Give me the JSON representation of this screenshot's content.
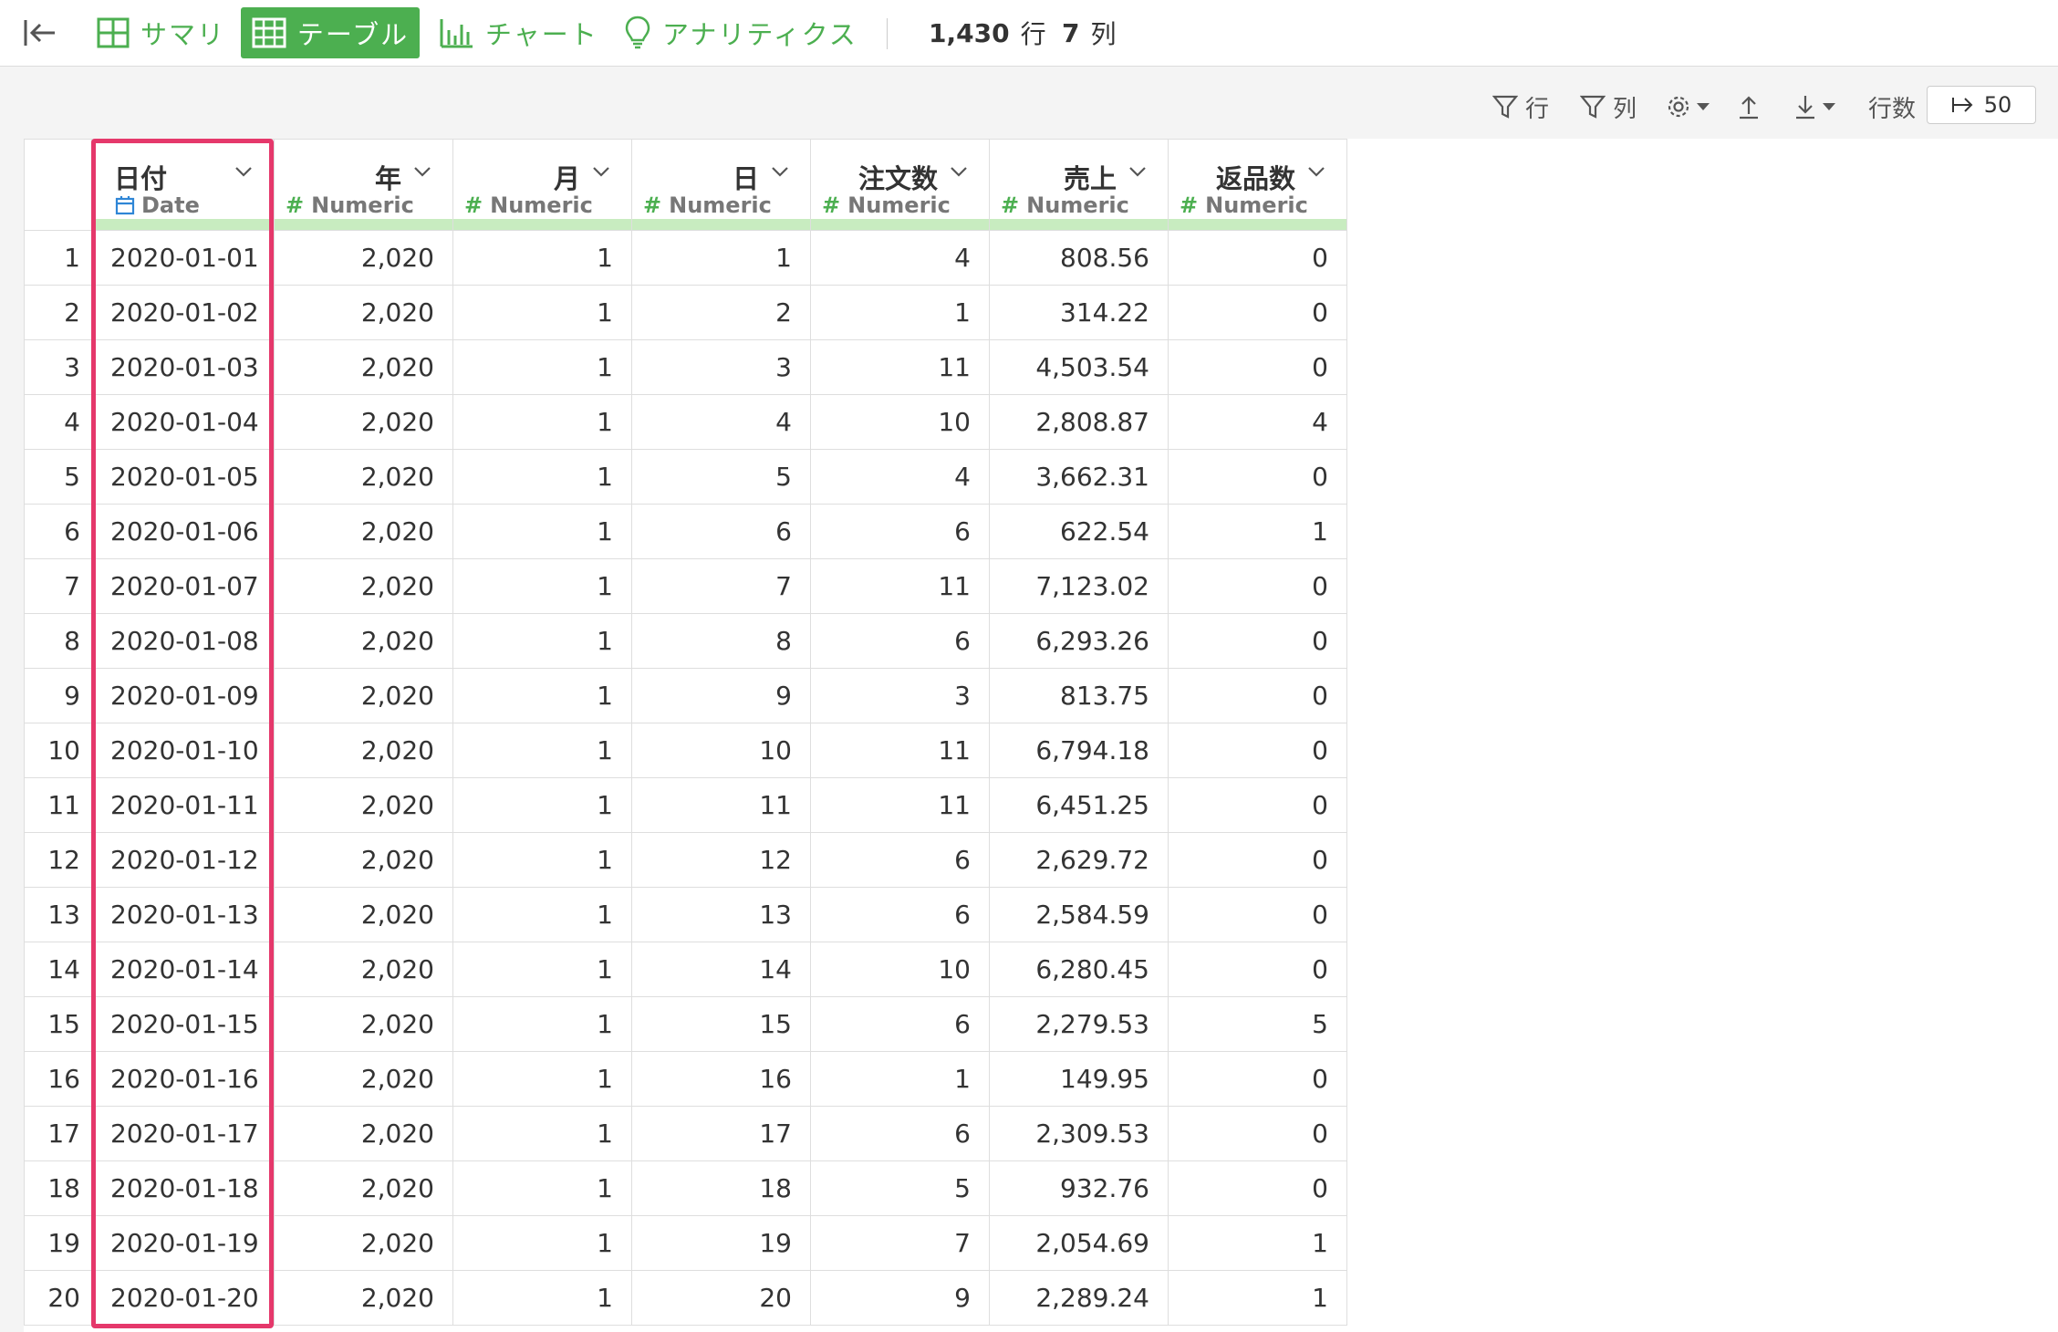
{
  "toolbar": {
    "summary_label": "サマリ",
    "table_label": "テーブル",
    "chart_label": "チャート",
    "analytics_label": "アナリティクス",
    "row_count": "1,430",
    "row_unit": "行",
    "col_count": "7",
    "col_unit": "列"
  },
  "controls": {
    "filter_rows_label": "行",
    "filter_cols_label": "列",
    "rows_label": "行数",
    "rows_value": "50"
  },
  "columns": [
    {
      "name": "日付",
      "type": "Date"
    },
    {
      "name": "年",
      "type": "Numeric"
    },
    {
      "name": "月",
      "type": "Numeric"
    },
    {
      "name": "日",
      "type": "Numeric"
    },
    {
      "name": "注文数",
      "type": "Numeric"
    },
    {
      "name": "売上",
      "type": "Numeric"
    },
    {
      "name": "返品数",
      "type": "Numeric"
    }
  ],
  "rows": [
    [
      "1",
      "2020-01-01",
      "2,020",
      "1",
      "1",
      "4",
      "808.56",
      "0"
    ],
    [
      "2",
      "2020-01-02",
      "2,020",
      "1",
      "2",
      "1",
      "314.22",
      "0"
    ],
    [
      "3",
      "2020-01-03",
      "2,020",
      "1",
      "3",
      "11",
      "4,503.54",
      "0"
    ],
    [
      "4",
      "2020-01-04",
      "2,020",
      "1",
      "4",
      "10",
      "2,808.87",
      "4"
    ],
    [
      "5",
      "2020-01-05",
      "2,020",
      "1",
      "5",
      "4",
      "3,662.31",
      "0"
    ],
    [
      "6",
      "2020-01-06",
      "2,020",
      "1",
      "6",
      "6",
      "622.54",
      "1"
    ],
    [
      "7",
      "2020-01-07",
      "2,020",
      "1",
      "7",
      "11",
      "7,123.02",
      "0"
    ],
    [
      "8",
      "2020-01-08",
      "2,020",
      "1",
      "8",
      "6",
      "6,293.26",
      "0"
    ],
    [
      "9",
      "2020-01-09",
      "2,020",
      "1",
      "9",
      "3",
      "813.75",
      "0"
    ],
    [
      "10",
      "2020-01-10",
      "2,020",
      "1",
      "10",
      "11",
      "6,794.18",
      "0"
    ],
    [
      "11",
      "2020-01-11",
      "2,020",
      "1",
      "11",
      "11",
      "6,451.25",
      "0"
    ],
    [
      "12",
      "2020-01-12",
      "2,020",
      "1",
      "12",
      "6",
      "2,629.72",
      "0"
    ],
    [
      "13",
      "2020-01-13",
      "2,020",
      "1",
      "13",
      "6",
      "2,584.59",
      "0"
    ],
    [
      "14",
      "2020-01-14",
      "2,020",
      "1",
      "14",
      "10",
      "6,280.45",
      "0"
    ],
    [
      "15",
      "2020-01-15",
      "2,020",
      "1",
      "15",
      "6",
      "2,279.53",
      "5"
    ],
    [
      "16",
      "2020-01-16",
      "2,020",
      "1",
      "16",
      "1",
      "149.95",
      "0"
    ],
    [
      "17",
      "2020-01-17",
      "2,020",
      "1",
      "17",
      "6",
      "2,309.53",
      "0"
    ],
    [
      "18",
      "2020-01-18",
      "2,020",
      "1",
      "18",
      "5",
      "932.76",
      "0"
    ],
    [
      "19",
      "2020-01-19",
      "2,020",
      "1",
      "19",
      "7",
      "2,054.69",
      "1"
    ],
    [
      "20",
      "2020-01-20",
      "2,020",
      "1",
      "20",
      "9",
      "2,289.24",
      "1"
    ]
  ],
  "colors": {
    "accent": "#4caf50",
    "highlight": "#e5386b",
    "header_bar": "#c8ecc0",
    "date_icon": "#2f86d6"
  }
}
